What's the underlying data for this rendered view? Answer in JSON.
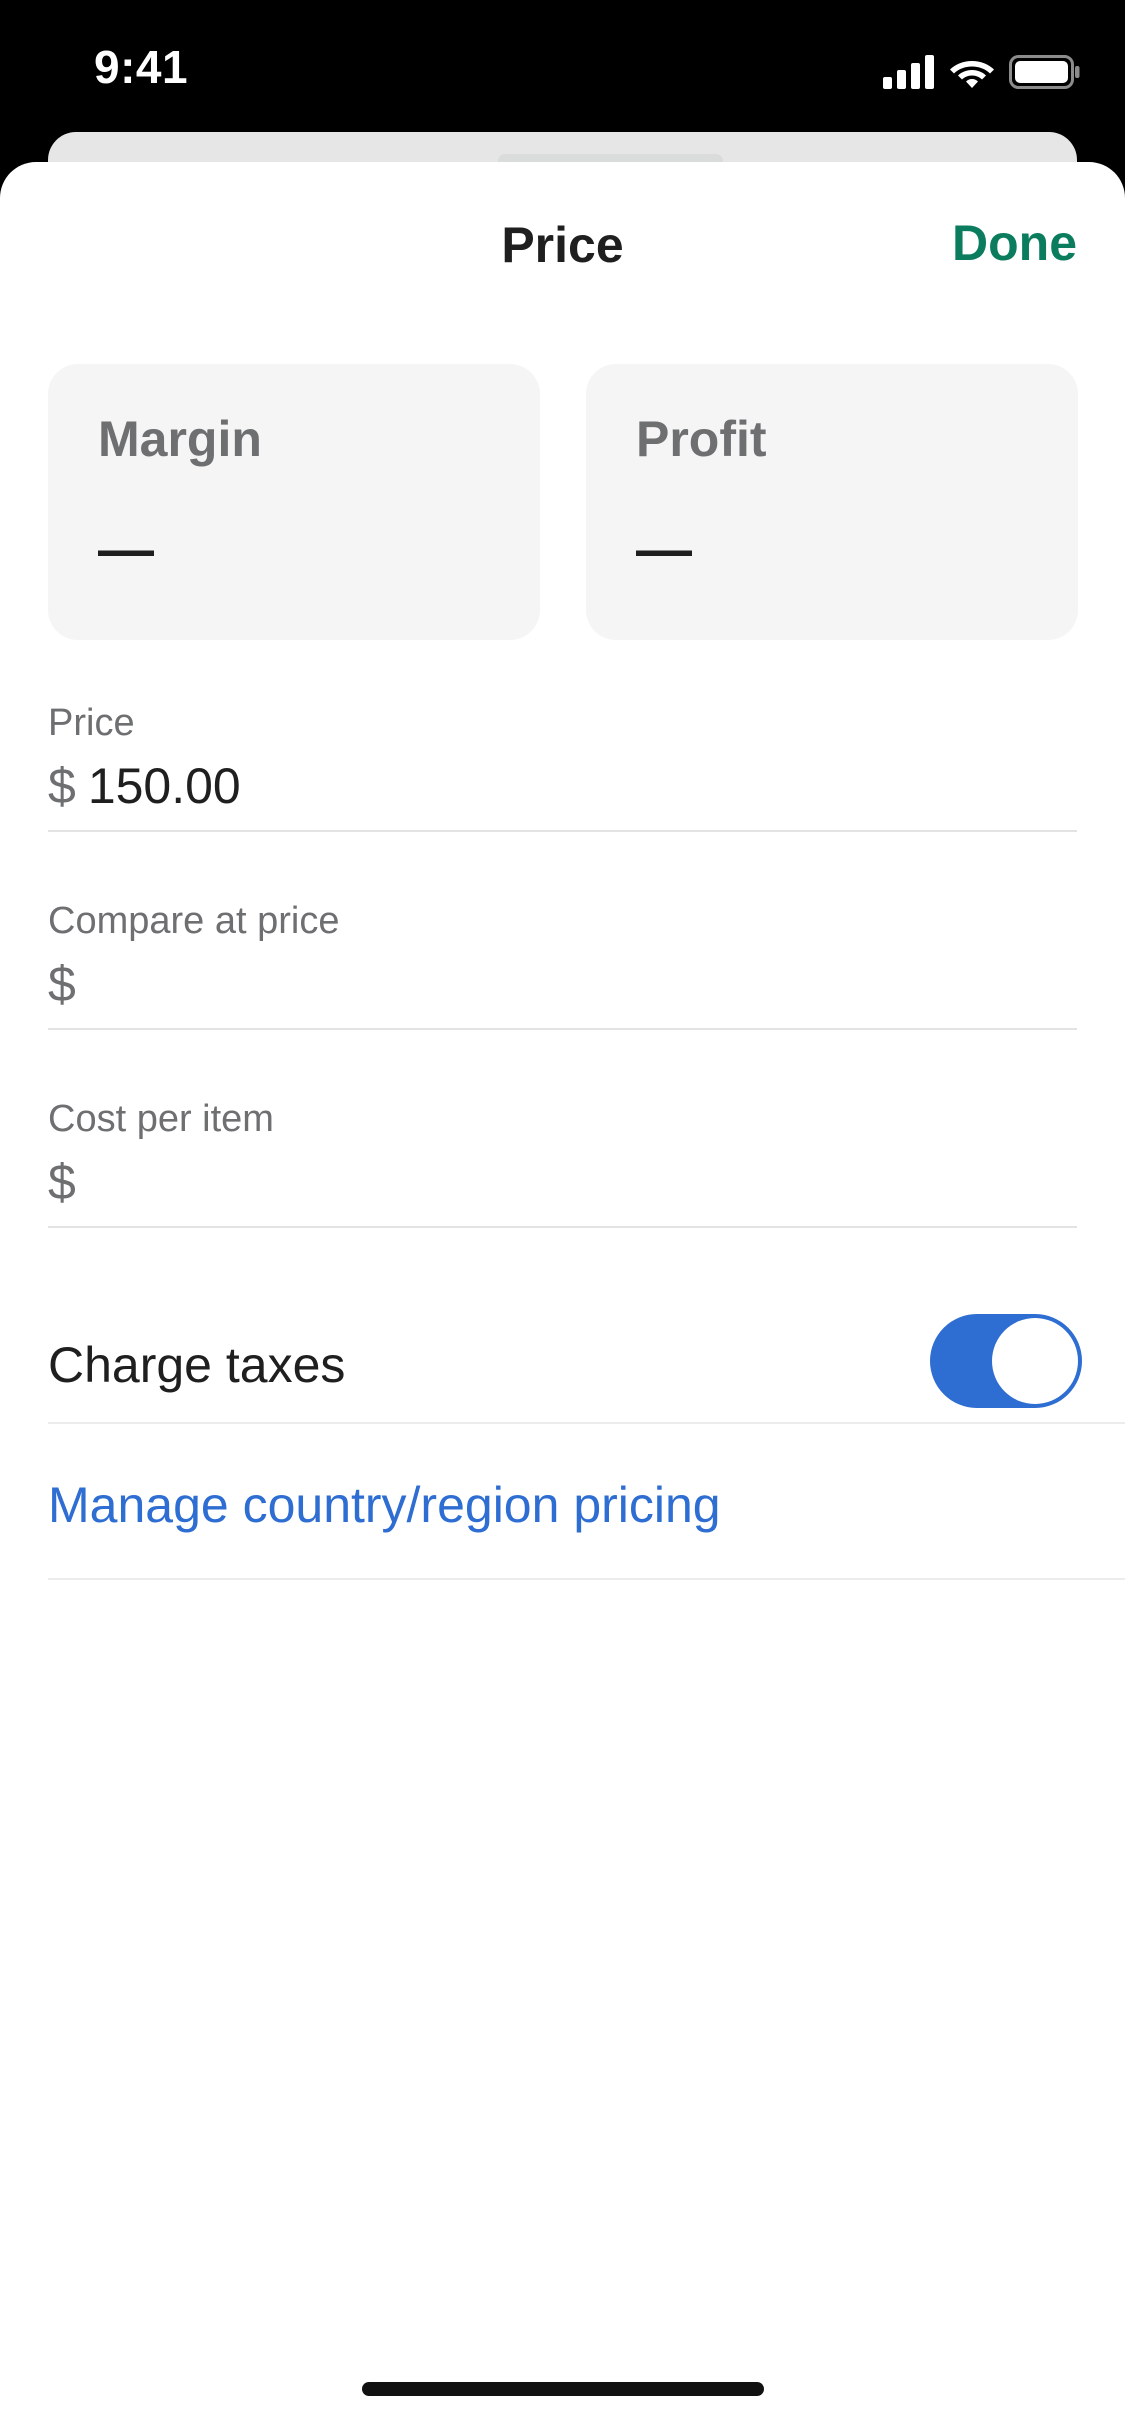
{
  "status_bar": {
    "time": "9:41",
    "icons": [
      "signal-icon",
      "wifi-icon",
      "battery-icon"
    ]
  },
  "header": {
    "title": "Price",
    "done_label": "Done"
  },
  "stats": {
    "margin": {
      "label": "Margin",
      "value": "—"
    },
    "profit": {
      "label": "Profit",
      "value": "—"
    }
  },
  "fields": {
    "price": {
      "label": "Price",
      "currency": "$",
      "value": "150.00"
    },
    "compare_at_price": {
      "label": "Compare at price",
      "currency": "$",
      "value": ""
    },
    "cost_per_item": {
      "label": "Cost per item",
      "currency": "$",
      "value": ""
    }
  },
  "charge_taxes": {
    "label": "Charge taxes",
    "enabled": true
  },
  "manage_pricing": {
    "label": "Manage country/region pricing"
  },
  "colors": {
    "accent_green": "#0b7d5e",
    "accent_blue": "#2e6dd1",
    "label_gray": "#6e6f71",
    "card_bg": "#f5f5f5"
  }
}
